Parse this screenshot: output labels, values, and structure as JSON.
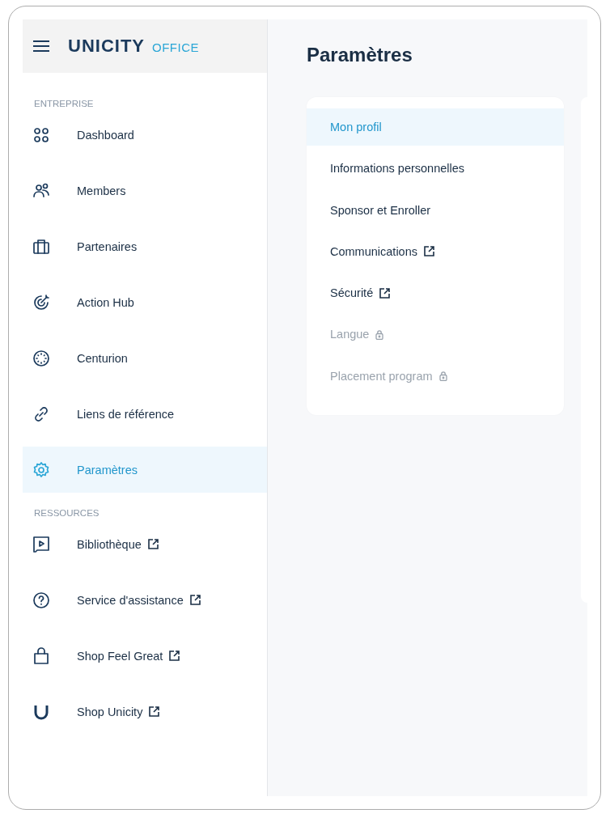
{
  "header": {
    "logo": "UNICITY",
    "logo_suffix": "OFFICE"
  },
  "sidebar": {
    "sections": [
      {
        "title": "ENTREPRISE",
        "items": [
          {
            "label": "Dashboard",
            "selected": false,
            "external": false
          },
          {
            "label": "Members",
            "selected": false,
            "external": false
          },
          {
            "label": "Partenaires",
            "selected": false,
            "external": false
          },
          {
            "label": "Action Hub",
            "selected": false,
            "external": false
          },
          {
            "label": "Centurion",
            "selected": false,
            "external": false
          },
          {
            "label": "Liens de référence",
            "selected": false,
            "external": false
          },
          {
            "label": "Paramètres",
            "selected": true,
            "external": false
          }
        ]
      },
      {
        "title": "RESSOURCES",
        "items": [
          {
            "label": "Bibliothèque",
            "selected": false,
            "external": true
          },
          {
            "label": "Service d'assistance",
            "selected": false,
            "external": true
          },
          {
            "label": "Shop Feel Great",
            "selected": false,
            "external": true
          },
          {
            "label": "Shop Unicity",
            "selected": false,
            "external": true
          }
        ]
      }
    ]
  },
  "main": {
    "title": "Paramètres",
    "settings_menu": [
      {
        "label": "Mon profil",
        "selected": true,
        "external": false,
        "locked": false
      },
      {
        "label": "Informations personnelles",
        "selected": false,
        "external": false,
        "locked": false
      },
      {
        "label": "Sponsor et Enroller",
        "selected": false,
        "external": false,
        "locked": false
      },
      {
        "label": "Communications",
        "selected": false,
        "external": true,
        "locked": false
      },
      {
        "label": "Sécurité",
        "selected": false,
        "external": true,
        "locked": false
      },
      {
        "label": "Langue",
        "selected": false,
        "external": false,
        "locked": true
      },
      {
        "label": "Placement program",
        "selected": false,
        "external": false,
        "locked": true
      }
    ]
  }
}
